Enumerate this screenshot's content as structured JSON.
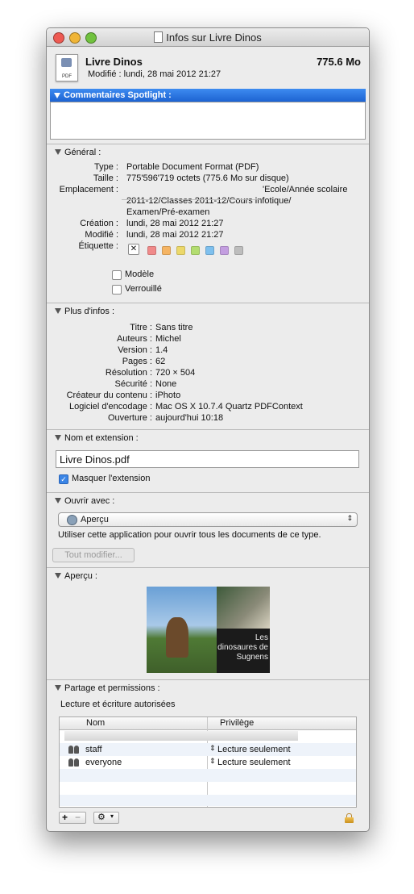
{
  "window": {
    "title": "Infos sur Livre Dinos"
  },
  "header": {
    "file_name": "Livre Dinos",
    "file_size": "775.6 Mo",
    "modified": "Modifié : lundi, 28 mai 2012 21:27",
    "icon_label": "PDF"
  },
  "spotlight": {
    "title": "Commentaires Spotlight :",
    "comment": ""
  },
  "general": {
    "title": "Général :",
    "rows": [
      {
        "label": "Type :",
        "value": "Portable Document Format (PDF)"
      },
      {
        "label": "Taille :",
        "value": "775'596'719 octets (775.6 Mo sur disque)"
      },
      {
        "label": "Emplacement :",
        "value": "'Ecole/Année scolaire"
      },
      {
        "label": "",
        "value": "2011-12/Classes 2011-12/Cours infotique/"
      },
      {
        "label": "",
        "value": "Examen/Pré-examen"
      },
      {
        "label": "Création :",
        "value": "lundi, 28 mai 2012 21:27"
      },
      {
        "label": "Modifié :",
        "value": "lundi, 28 mai 2012 21:27"
      },
      {
        "label": "Étiquette :",
        "value": ""
      }
    ],
    "tag_colors": [
      "#f08a8a",
      "#f5b463",
      "#ecd86a",
      "#b3dd70",
      "#7ec0ee",
      "#c39ee0",
      "#bdbdbd"
    ],
    "no_label_glyph": "✕",
    "stationery_label": "Modèle",
    "locked_label": "Verrouillé"
  },
  "more_info": {
    "title": "Plus d'infos :",
    "rows": [
      {
        "label": "Titre :",
        "value": "Sans titre"
      },
      {
        "label": "Auteurs :",
        "value": "Michel"
      },
      {
        "label": "Version :",
        "value": "1.4"
      },
      {
        "label": "Pages :",
        "value": "62"
      },
      {
        "label": "Résolution :",
        "value": "720 × 504"
      },
      {
        "label": "Sécurité :",
        "value": "None"
      },
      {
        "label": "Créateur du contenu :",
        "value": "iPhoto"
      },
      {
        "label": "Logiciel d'encodage :",
        "value": "Mac OS X 10.7.4 Quartz PDFContext"
      },
      {
        "label": "Ouverture :",
        "value": "aujourd'hui 10:18"
      }
    ]
  },
  "name_ext": {
    "title": "Nom et extension :",
    "name_value": "Livre Dinos.pdf",
    "hide_ext_label": "Masquer l'extension",
    "hide_ext_checked": true
  },
  "open_with": {
    "title": "Ouvrir avec :",
    "app": "Aperçu",
    "description": "Utiliser cette application pour ouvrir tous les documents de ce type.",
    "change_all_label": "Tout modifier..."
  },
  "preview": {
    "title": "Aperçu :",
    "overlay_lines": [
      "Les",
      "dinosaures de",
      "Sugnens"
    ]
  },
  "sharing": {
    "title": "Partage et permissions :",
    "summary": "Lecture et écriture autorisées",
    "columns": [
      "Nom",
      "Privilège"
    ],
    "rows": [
      {
        "name": "staff",
        "privilege": "Lecture seulement"
      },
      {
        "name": "everyone",
        "privilege": "Lecture seulement"
      }
    ],
    "add_label": "+",
    "remove_label": "−",
    "gear_glyph": "⚙",
    "menu_arrow": "▾",
    "updown_glyph": "⇕"
  }
}
